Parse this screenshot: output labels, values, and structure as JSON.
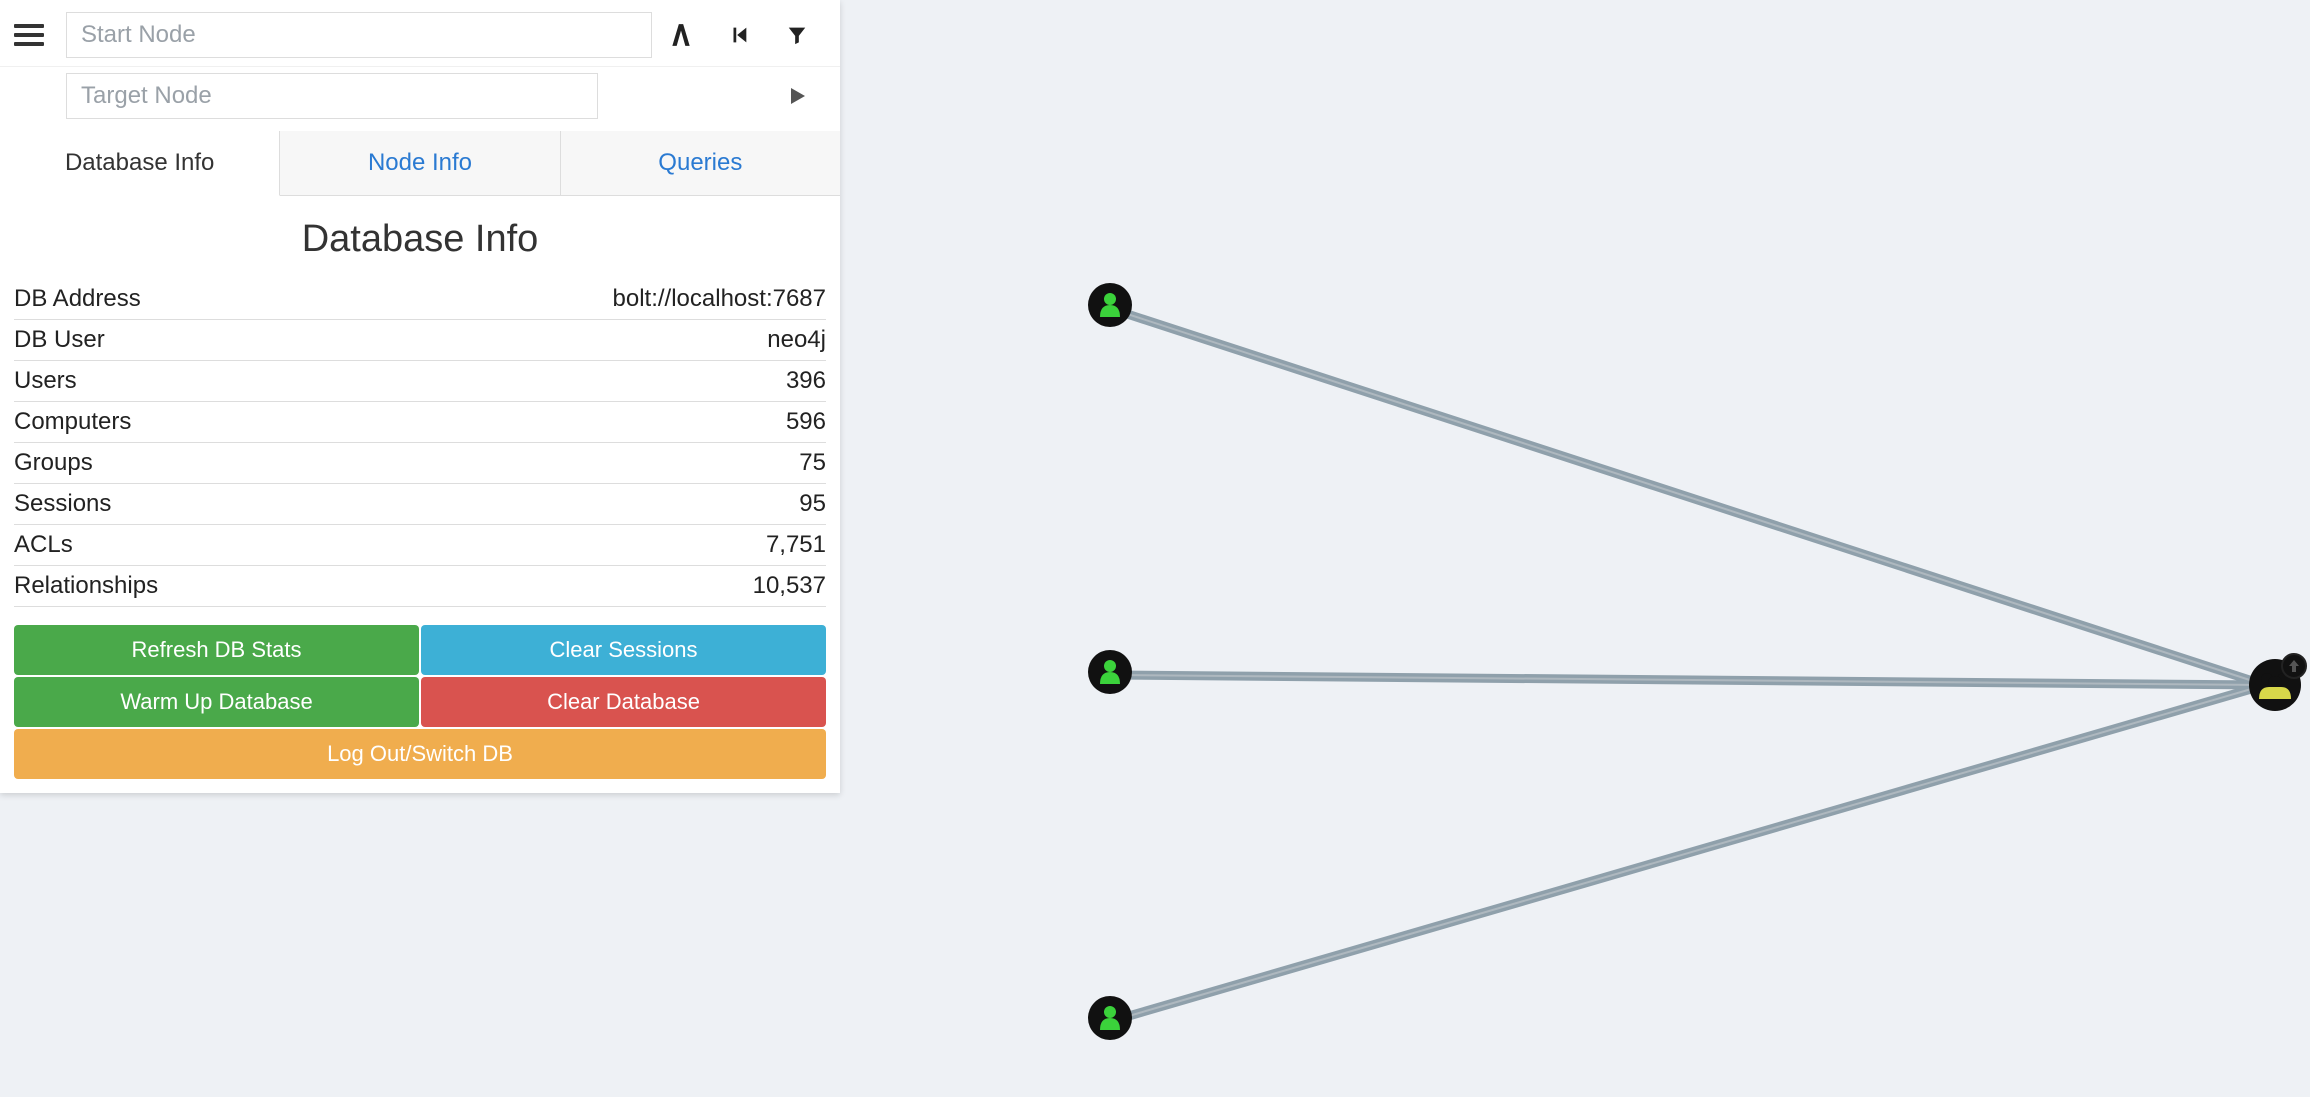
{
  "search": {
    "start_placeholder": "Start Node",
    "target_placeholder": "Target Node"
  },
  "tabs": {
    "db": "Database Info",
    "node": "Node Info",
    "queries": "Queries"
  },
  "panel_title": "Database Info",
  "stats": {
    "db_address_label": "DB Address",
    "db_address_value": "bolt://localhost:7687",
    "db_user_label": "DB User",
    "db_user_value": "neo4j",
    "users_label": "Users",
    "users_value": "396",
    "computers_label": "Computers",
    "computers_value": "596",
    "groups_label": "Groups",
    "groups_value": "75",
    "sessions_label": "Sessions",
    "sessions_value": "95",
    "acls_label": "ACLs",
    "acls_value": "7,751",
    "relationships_label": "Relationships",
    "relationships_value": "10,537"
  },
  "buttons": {
    "refresh": "Refresh DB Stats",
    "clear_sessions": "Clear Sessions",
    "warm_up": "Warm Up Database",
    "clear_db": "Clear Database",
    "logout": "Log Out/Switch DB"
  },
  "icons": {
    "hamburger": "menu-icon",
    "road": "pathfinding-icon",
    "step_back": "back-icon",
    "filter": "filter-icon",
    "play": "play-icon"
  }
}
